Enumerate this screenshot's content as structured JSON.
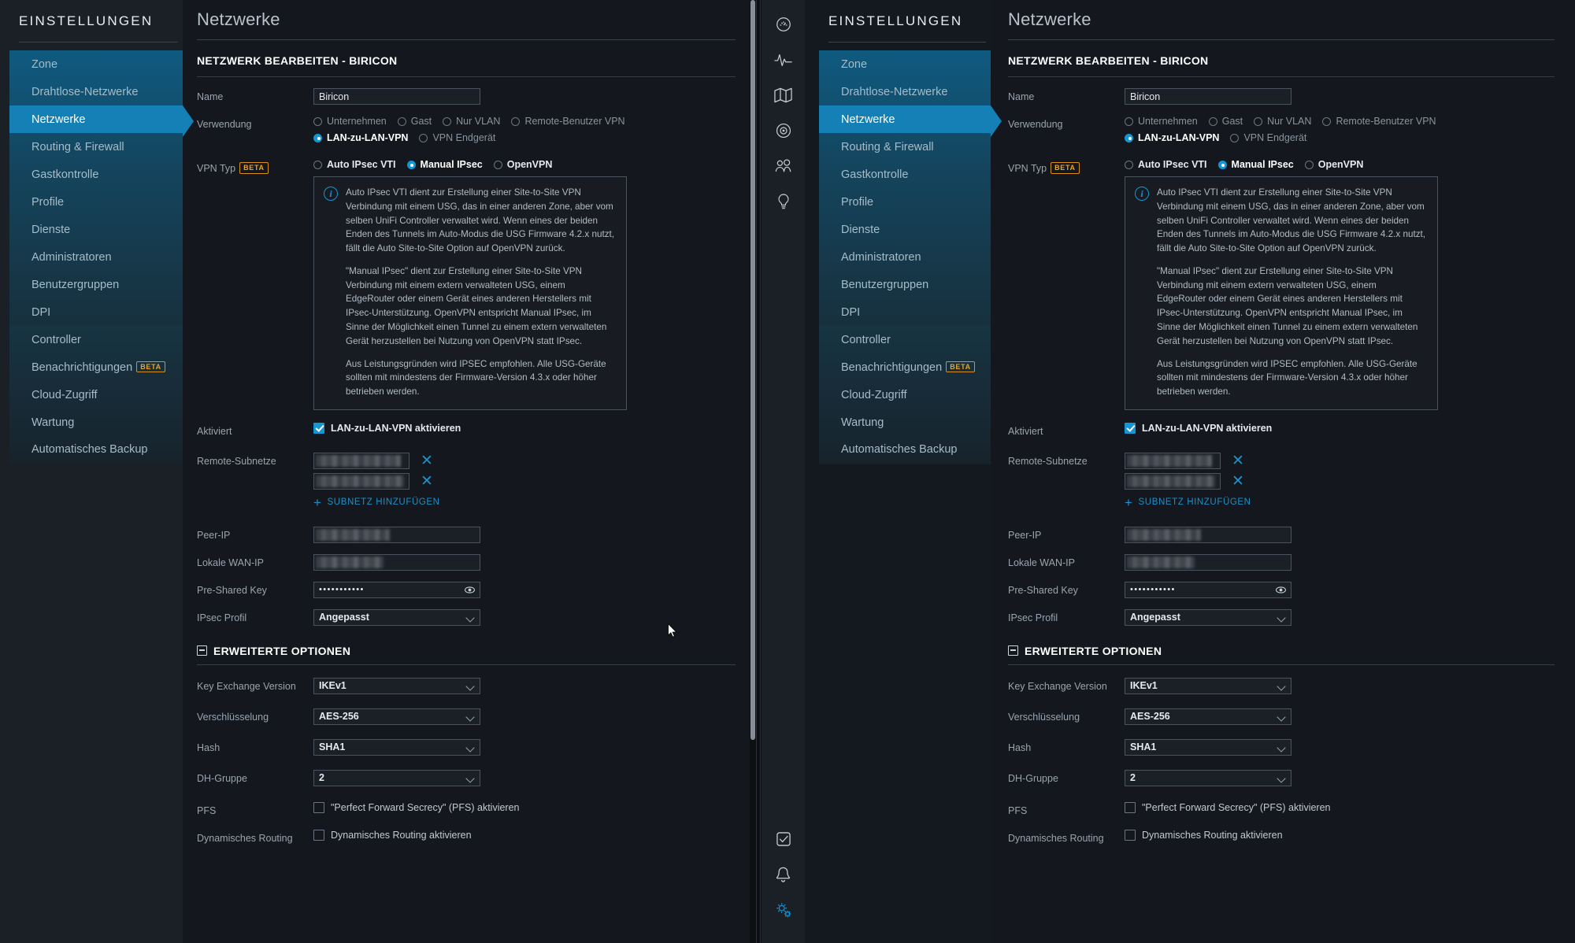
{
  "sidebar": {
    "title": "EINSTELLUNGEN",
    "group_main": [
      {
        "label": "Zone",
        "active": false
      },
      {
        "label": "Drahtlose-Netzwerke",
        "active": false
      },
      {
        "label": "Netzwerke",
        "active": true
      },
      {
        "label": "Routing & Firewall",
        "active": false
      },
      {
        "label": "Gastkontrolle",
        "active": false
      },
      {
        "label": "Profile",
        "active": false
      },
      {
        "label": "Dienste",
        "active": false
      },
      {
        "label": "Administratoren",
        "active": false
      },
      {
        "label": "Benutzergruppen",
        "active": false
      },
      {
        "label": "DPI",
        "active": false
      }
    ],
    "group_lower": [
      {
        "label": "Controller",
        "badge": ""
      },
      {
        "label": "Benachrichtigungen",
        "badge": "BETA"
      },
      {
        "label": "Cloud-Zugriff",
        "badge": ""
      },
      {
        "label": "Wartung",
        "badge": ""
      },
      {
        "label": "Automatisches Backup",
        "badge": ""
      }
    ]
  },
  "page": {
    "title": "Netzwerke",
    "section_title": "NETZWERK BEARBEITEN - BIRICON"
  },
  "form": {
    "name_label": "Name",
    "name_value": "Biricon",
    "usage_label": "Verwendung",
    "usage_options_row1": [
      {
        "label": "Unternehmen",
        "selected": false
      },
      {
        "label": "Gast",
        "selected": false
      },
      {
        "label": "Nur VLAN",
        "selected": false
      },
      {
        "label": "Remote-Benutzer VPN",
        "selected": false
      }
    ],
    "usage_options_row2": [
      {
        "label": "LAN-zu-LAN-VPN",
        "selected": true
      },
      {
        "label": "VPN Endgerät",
        "selected": false
      }
    ],
    "vpn_type_label": "VPN Typ",
    "vpn_type_badge": "BETA",
    "vpn_type_options": [
      {
        "label": "Auto IPsec VTI",
        "selected": false
      },
      {
        "label": "Manual IPsec",
        "selected": true
      },
      {
        "label": "OpenVPN",
        "selected": false
      }
    ],
    "info_paragraphs": [
      "Auto IPsec VTI dient zur Erstellung einer Site-to-Site VPN Verbindung mit einem USG, das in einer anderen Zone, aber vom selben UniFi Controller verwaltet wird. Wenn eines der beiden Enden des Tunnels im Auto-Modus die USG Firmware 4.2.x nutzt, fällt die Auto Site-to-Site Option auf OpenVPN zurück.",
      "\"Manual IPsec\" dient zur Erstellung einer Site-to-Site VPN Verbindung mit einem extern verwalteten USG, einem EdgeRouter oder einem Gerät eines anderen Herstellers mit IPsec-Unterstützung. OpenVPN entspricht Manual IPsec, im Sinne der Möglichkeit einen Tunnel zu einem extern verwalteten Gerät herzustellen bei Nutzung von OpenVPN statt IPsec.",
      "Aus Leistungsgründen wird IPSEC empfohlen. Alle USG-Geräte sollten mit mindestens der Firmware-Version 4.3.x oder höher betrieben werden."
    ],
    "enabled_label": "Aktiviert",
    "enabled_checkbox_label": "LAN-zu-LAN-VPN aktivieren",
    "enabled_checked": true,
    "remote_subnets_label": "Remote-Subnetze",
    "remote_subnets": [
      {
        "value": "",
        "redacted": true
      },
      {
        "value": "",
        "redacted": true
      }
    ],
    "add_subnet_label": "SUBNETZ HINZUFÜGEN",
    "peer_ip_label": "Peer-IP",
    "peer_ip_value": "",
    "local_wan_label": "Lokale WAN-IP",
    "local_wan_value": "",
    "psk_label": "Pre-Shared Key",
    "psk_value": "•••••••••••",
    "ipsec_profile_label": "IPsec Profil",
    "ipsec_profile_value": "Angepasst",
    "advanced_title": "ERWEITERTE OPTIONEN",
    "key_exchange_label": "Key Exchange Version",
    "key_exchange_value": "IKEv1",
    "encryption_label": "Verschlüsselung",
    "encryption_value": "AES-256",
    "hash_label": "Hash",
    "hash_value": "SHA1",
    "dh_group_label": "DH-Gruppe",
    "dh_group_value": "2",
    "pfs_label": "PFS",
    "pfs_checkbox_label": "\"Perfect Forward Secrecy\" (PFS) aktivieren",
    "pfs_checked": false,
    "dyn_routing_label": "Dynamisches Routing",
    "dyn_routing_checkbox_label": "Dynamisches Routing aktivieren",
    "dyn_routing_checked": false
  },
  "rail": {
    "top_icons": [
      "dashboard-icon",
      "statistics-icon",
      "map-icon",
      "target-icon",
      "clients-icon",
      "insights-icon"
    ],
    "bottom_icons": [
      "tasks-icon",
      "alerts-icon",
      "settings-icon"
    ]
  },
  "colors": {
    "accent": "#1496d4",
    "nav_active": "#1480b5",
    "beta_border": "#d98f16",
    "panel_bg": "#14171d",
    "sidebar_bg": "#1b1f26",
    "link": "#1e90c8"
  }
}
